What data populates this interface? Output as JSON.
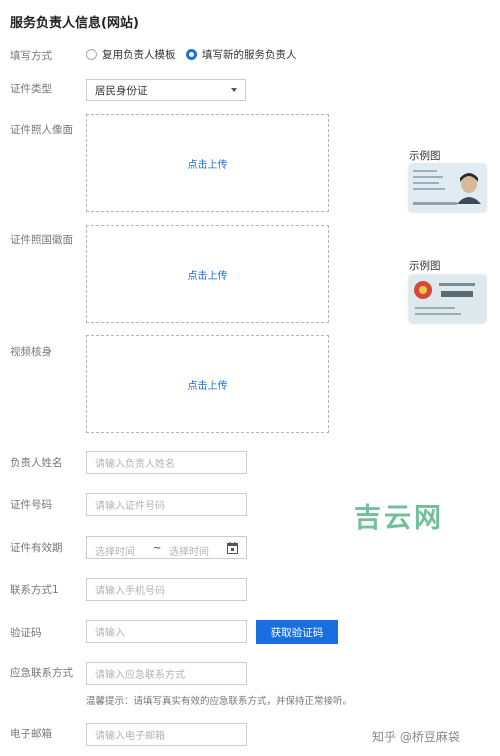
{
  "section_title": "服务负责人信息(网站)",
  "fill_method": {
    "label": "填写方式",
    "options": [
      "复用负责人模板",
      "填写新的服务负责人"
    ],
    "selected": "填写新的服务负责人"
  },
  "id_type": {
    "label": "证件类型",
    "value": "居民身份证"
  },
  "id_front": {
    "label": "证件照人像面",
    "upload": "点击上传",
    "example_label": "示例图"
  },
  "id_back": {
    "label": "证件照国徽面",
    "upload": "点击上传",
    "example_label": "示例图"
  },
  "video_check": {
    "label": "视频核身",
    "upload": "点击上传"
  },
  "name": {
    "label": "负责人姓名",
    "placeholder": "请输入负责人姓名"
  },
  "id_number": {
    "label": "证件号码",
    "placeholder": "请输入证件号码"
  },
  "validity": {
    "label": "证件有效期",
    "start_placeholder": "选择时间",
    "separator": "~",
    "end_placeholder": "选择时间"
  },
  "phone": {
    "label": "联系方式1",
    "placeholder": "请输入手机号码"
  },
  "captcha": {
    "label": "验证码",
    "placeholder": "请输入",
    "button": "获取验证码"
  },
  "emergency": {
    "label": "应急联系方式",
    "placeholder": "请输入应急联系方式",
    "hint": "温馨提示：请填写真实有效的应急联系方式，并保持正常接听。"
  },
  "email": {
    "label": "电子邮箱",
    "placeholder": "请输入电子邮箱"
  },
  "watermark_big": "吉云网",
  "watermark_small": "知乎 @桥豆麻袋",
  "colors": {
    "accent": "#1a6fe0",
    "watermark": "#5bb58a"
  }
}
